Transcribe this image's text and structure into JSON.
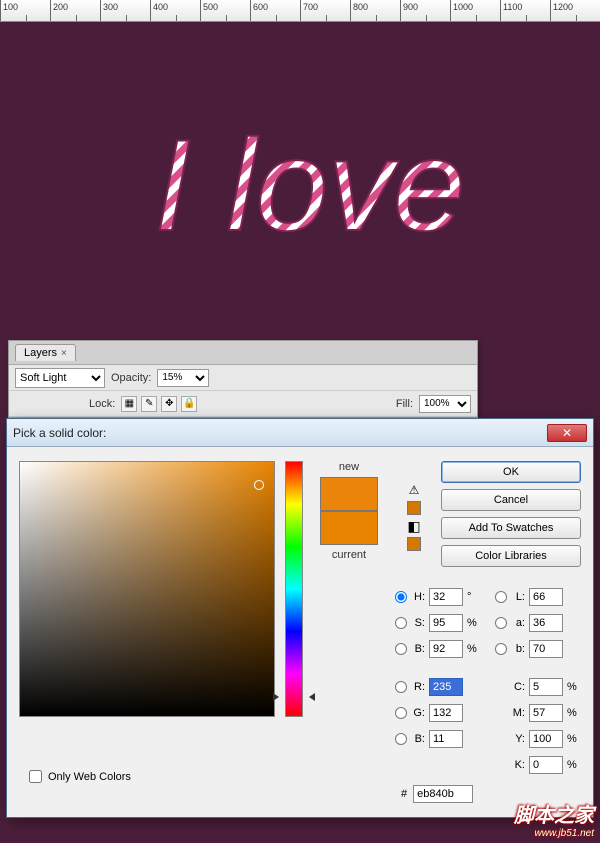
{
  "ruler": {
    "ticks": [
      "100",
      "200",
      "300",
      "400",
      "500",
      "600",
      "700",
      "800",
      "900",
      "1000",
      "1100",
      "1200"
    ]
  },
  "canvas": {
    "artwork_text": "I love"
  },
  "layers": {
    "tab": "Layers",
    "blend_mode": "Soft Light",
    "opacity_label": "Opacity:",
    "opacity_value": "15%",
    "lock_label": "Lock:",
    "fill_label": "Fill:",
    "fill_value": "100%"
  },
  "dialog": {
    "title": "Pick a solid color:",
    "new_label": "new",
    "current_label": "current",
    "buttons": {
      "ok": "OK",
      "cancel": "Cancel",
      "swatches": "Add To Swatches",
      "libraries": "Color Libraries"
    },
    "hsb": {
      "h": "32",
      "s": "95",
      "b": "92"
    },
    "rgb": {
      "r": "235",
      "g": "132",
      "b": "11"
    },
    "lab": {
      "l": "66",
      "a": "36",
      "b2": "70"
    },
    "cmyk": {
      "c": "5",
      "m": "57",
      "y": "100",
      "k": "0"
    },
    "hex": "eb840b",
    "units": {
      "deg": "°",
      "pct": "%"
    },
    "only_web": "Only Web Colors",
    "color": "#eb840b",
    "hue_pos_pct": 91
  },
  "watermark": {
    "text": "脚本之家",
    "url": "www.jb51.net"
  }
}
